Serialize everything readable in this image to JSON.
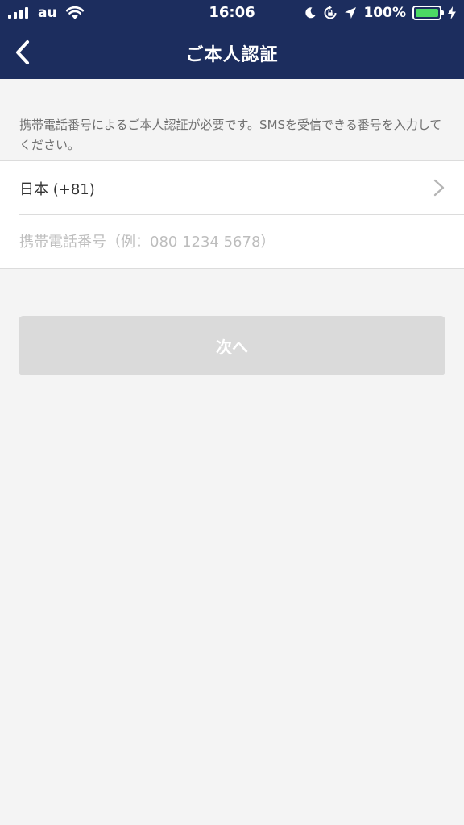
{
  "status_bar": {
    "carrier": "au",
    "time": "16:06",
    "battery_percent": "100%",
    "battery_level": 1.0,
    "icons": [
      "signal-icon",
      "wifi-icon",
      "moon-icon",
      "rotation-lock-icon",
      "location-arrow-icon",
      "battery-icon",
      "charging-bolt-icon"
    ]
  },
  "navbar": {
    "title": "ご本人認証",
    "back_icon": "chevron-left-icon"
  },
  "description": "携帯電話番号によるご本人認証が必要です。SMSを受信できる番号を入力してください。",
  "form": {
    "country_label": "日本 (+81)",
    "country_icon": "chevron-right-icon",
    "phone_value": "",
    "phone_placeholder": "携帯電話番号（例：080 1234 5678）"
  },
  "next_button": {
    "label": "次へ"
  },
  "colors": {
    "navbar_bg": "#1c2d5e",
    "page_bg": "#f4f4f4",
    "button_disabled_bg": "#dadada",
    "battery_green": "#4cd964"
  }
}
